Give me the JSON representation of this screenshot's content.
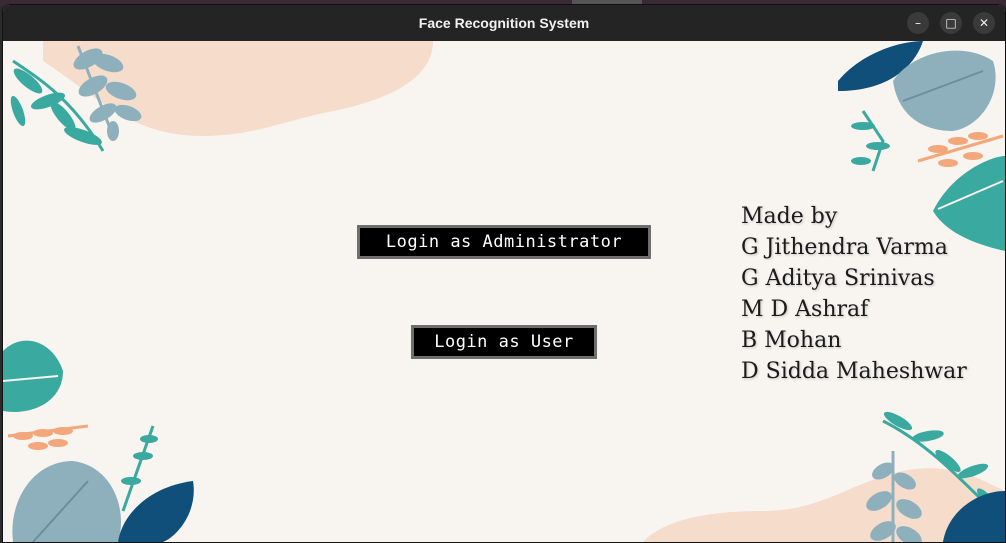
{
  "window": {
    "title": "Face Recognition System"
  },
  "controls": {
    "minimize": "–",
    "maximize": "□",
    "close": "✕"
  },
  "buttons": {
    "admin_label": "Login as Administrator",
    "user_label": "Login as User"
  },
  "credits": {
    "heading": "Made by",
    "names": [
      "G Jithendra Varma",
      "G Aditya Srinivas",
      "M D Ashraf",
      "B Mohan",
      "D Sidda Maheshwar"
    ]
  },
  "colors": {
    "teal": "#3aa9a0",
    "navy": "#0f4f7a",
    "grey_blue": "#8eb0bd",
    "peach": "#f3a77a",
    "blob": "#f6dccb",
    "background": "#f8f4ef"
  }
}
